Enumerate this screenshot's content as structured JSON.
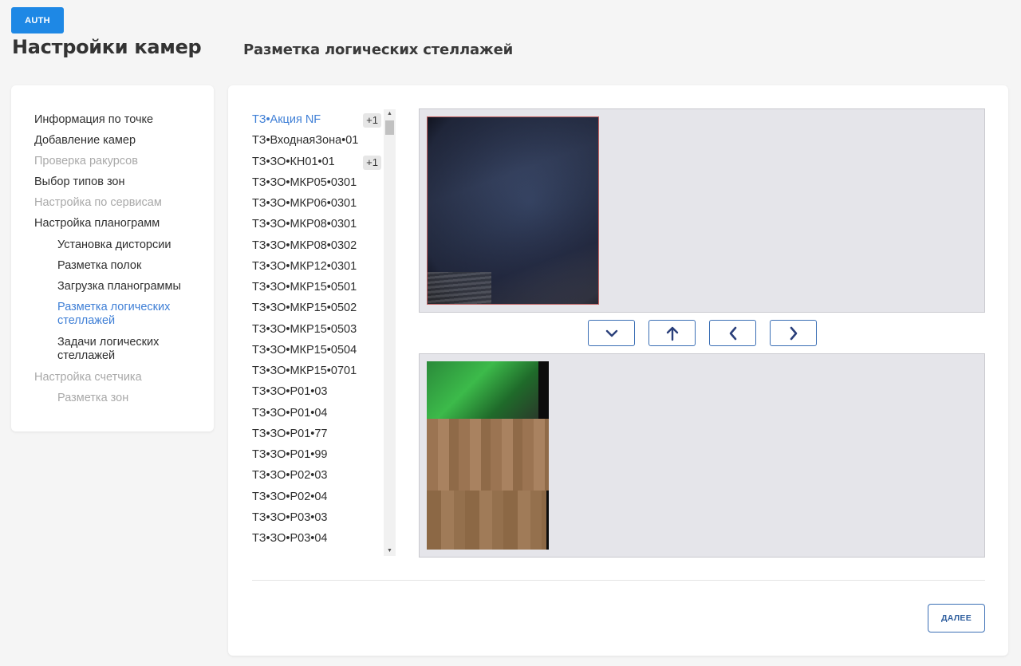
{
  "auth_button": "AUTH",
  "page_title": "Настройки камер",
  "section_title": "Разметка логических стеллажей",
  "sidebar": {
    "items": [
      {
        "label": "Информация по точке",
        "state": "enabled"
      },
      {
        "label": "Добавление камер",
        "state": "enabled"
      },
      {
        "label": "Проверка ракурсов",
        "state": "disabled"
      },
      {
        "label": "Выбор типов зон",
        "state": "enabled"
      },
      {
        "label": "Настройка по сервисам",
        "state": "disabled"
      },
      {
        "label": "Настройка планограмм",
        "state": "enabled"
      },
      {
        "label": "Установка дисторсии",
        "state": "enabled"
      },
      {
        "label": "Разметка полок",
        "state": "enabled"
      },
      {
        "label": "Загрузка планограммы",
        "state": "enabled"
      },
      {
        "label": "Разметка логических стеллажей",
        "state": "active"
      },
      {
        "label": "Задачи логических стеллажей",
        "state": "enabled"
      },
      {
        "label": "Настройка счетчика",
        "state": "disabled"
      },
      {
        "label": "Разметка зон",
        "state": "disabled"
      }
    ]
  },
  "shelves": [
    {
      "label": "ТЗ•Акция NF",
      "badge": "+1",
      "active": true
    },
    {
      "label": "ТЗ•ВходнаяЗона•01"
    },
    {
      "label": "ТЗ•ЗО•КН01•01",
      "badge": "+1"
    },
    {
      "label": "ТЗ•ЗО•МКР05•0301"
    },
    {
      "label": "ТЗ•ЗО•МКР06•0301"
    },
    {
      "label": "ТЗ•ЗО•МКР08•0301"
    },
    {
      "label": "ТЗ•ЗО•МКР08•0302"
    },
    {
      "label": "ТЗ•ЗО•МКР12•0301"
    },
    {
      "label": "ТЗ•ЗО•МКР15•0501"
    },
    {
      "label": "ТЗ•ЗО•МКР15•0502"
    },
    {
      "label": "ТЗ•ЗО•МКР15•0503"
    },
    {
      "label": "ТЗ•ЗО•МКР15•0504"
    },
    {
      "label": "ТЗ•ЗО•МКР15•0701"
    },
    {
      "label": "ТЗ•ЗО•Р01•03"
    },
    {
      "label": "ТЗ•ЗО•Р01•04"
    },
    {
      "label": "ТЗ•ЗО•Р01•77"
    },
    {
      "label": "ТЗ•ЗО•Р01•99"
    },
    {
      "label": "ТЗ•ЗО•Р02•03"
    },
    {
      "label": "ТЗ•ЗО•Р02•04"
    },
    {
      "label": "ТЗ•ЗО•Р03•03"
    },
    {
      "label": "ТЗ•ЗО•Р03•04"
    }
  ],
  "nav_icons": [
    "chevron-down-icon",
    "arrow-up-icon",
    "chevron-left-icon",
    "chevron-right-icon"
  ],
  "next_button": "ДАЛЕЕ",
  "colors": {
    "accent": "#1e88e5",
    "active_text": "#3f7fd6",
    "muted_text": "#a9a9a9",
    "outline_button": "#3b6fb5"
  }
}
